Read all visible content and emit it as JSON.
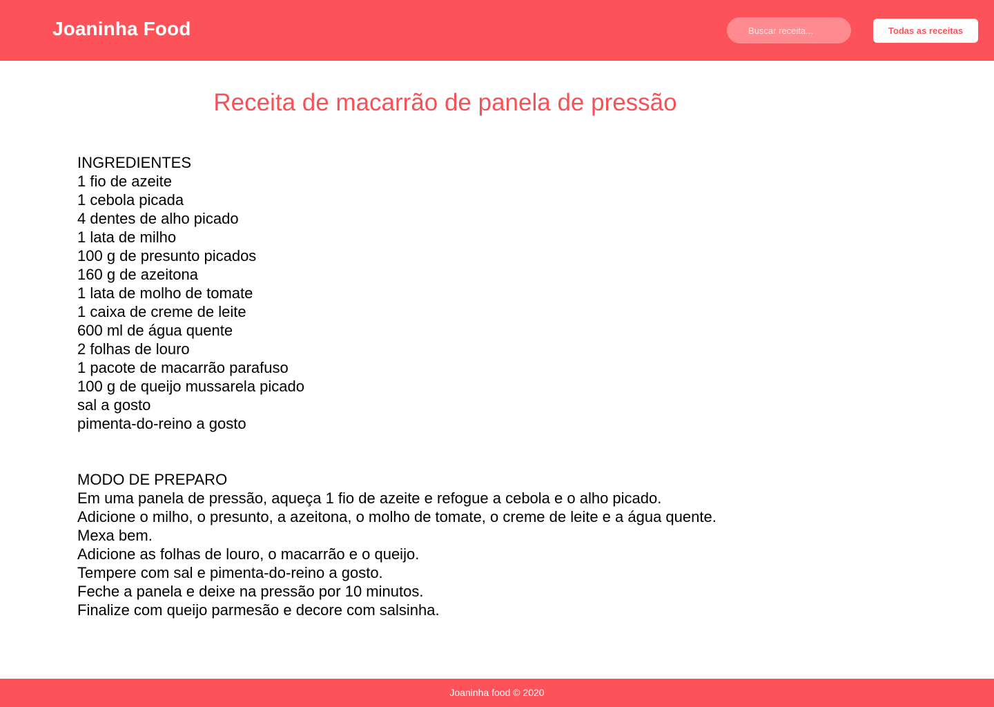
{
  "header": {
    "brand": "Joaninha Food",
    "search_placeholder": "Buscar receita...",
    "all_recipes_label": "Todas as receitas"
  },
  "recipe": {
    "title": "Receita de macarrão de panela de pressão",
    "ingredients_heading": "INGREDIENTES",
    "ingredients": [
      "1 fio de azeite",
      "1 cebola picada",
      "4 dentes de alho picado",
      "1 lata de milho",
      "100 g de presunto picados",
      "160 g de azeitona",
      "1 lata de molho de tomate",
      "1 caixa de creme de leite",
      "600 ml de água quente",
      "2 folhas de louro",
      "1 pacote de macarrão parafuso",
      "100 g de queijo mussarela picado",
      "sal a gosto",
      "pimenta-do-reino a gosto"
    ],
    "method_heading": "MODO DE PREPARO",
    "method": [
      "Em uma panela de pressão, aqueça 1 fio de azeite e refogue a cebola e o alho picado.",
      "Adicione o milho, o presunto, a azeitona, o molho de tomate, o creme de leite e a água quente.",
      "Mexa bem.",
      "Adicione as folhas de louro, o macarrão e o queijo.",
      "Tempere com sal e pimenta-do-reino a gosto.",
      "Feche a panela e deixe na pressão por 10 minutos.",
      "Finalize com queijo parmesão e decore com salsinha."
    ]
  },
  "footer": {
    "text": "Joaninha food © 2020"
  },
  "colors": {
    "accent": "#fe525a",
    "search_bg": "#ff8a8f",
    "title": "#f65157"
  }
}
